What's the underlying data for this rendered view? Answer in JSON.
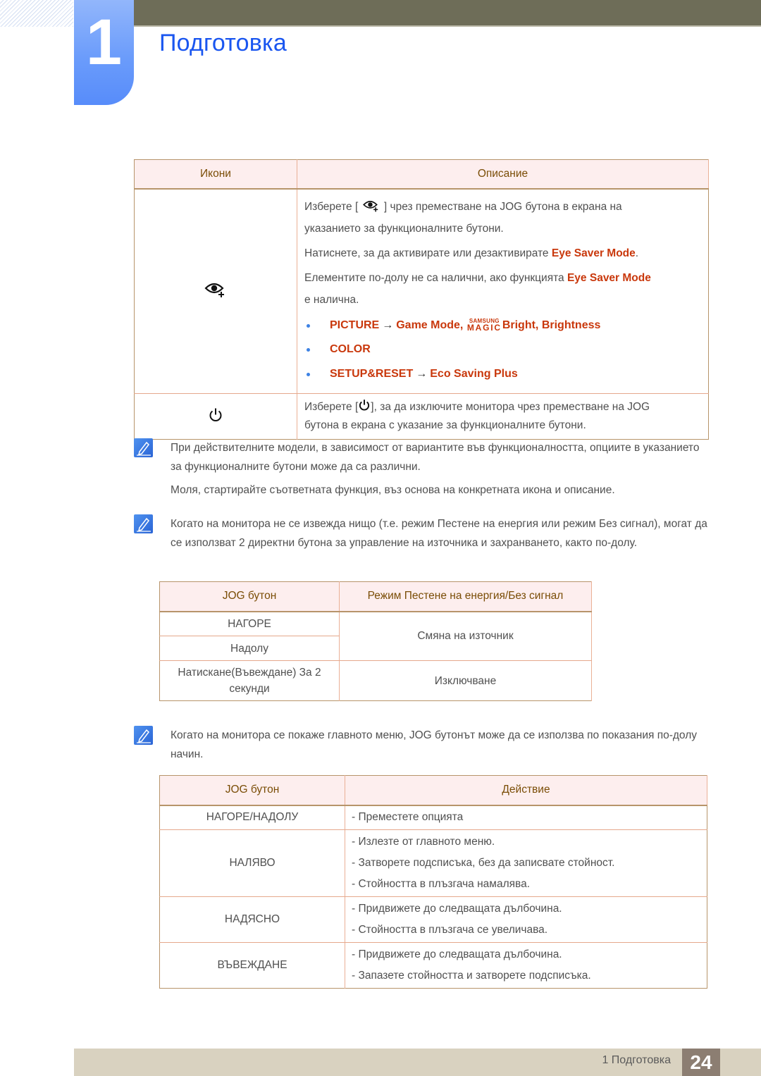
{
  "header": {
    "chapter_number": "1",
    "chapter_title": "Подготовка",
    "colors": {
      "topbar": "#6e6d58",
      "chapter_block": "#6b9cfb",
      "title": "#1a56f0"
    }
  },
  "icons_table": {
    "headers": [
      "Икони",
      "Описание"
    ],
    "rows": [
      {
        "icon": "eye-saver-icon",
        "desc": {
          "p1_before": "Изберете [",
          "p1_after": "] чрез преместване на JOG бутона в екрана на",
          "p1_line2": "указанието за функционалните бутони.",
          "p2_before": "Натиснете, за да активирате или дезактивирате ",
          "p2_hl": "Eye Saver Mode",
          "p2_after": ".",
          "p3_before": "Елементите по-долу не са налични, ако функцията ",
          "p3_hl": "Eye Saver Mode",
          "p3_line2": "е налична.",
          "bullets": [
            {
              "parts": [
                "PICTURE",
                "→",
                "Game Mode",
                ", ",
                "SAMSUNG",
                "MAGIC",
                "Bright",
                ", ",
                "Brightness"
              ]
            },
            {
              "parts": [
                "COLOR"
              ]
            },
            {
              "parts": [
                "SETUP&RESET",
                "→",
                "Eco Saving Plus"
              ]
            }
          ]
        }
      },
      {
        "icon": "power-icon",
        "desc": {
          "p1_before": "Изберете [",
          "p1_after": "], за да изключите монитора чрез преместване на JOG",
          "p1_line2": "бутона в екрана с указание за функционалните бутони."
        }
      }
    ]
  },
  "notes": [
    {
      "paragraphs": [
        "При действителните модели, в зависимост от вариантите във функционалността, опциите в указанието за функционалните бутони може да са различни.",
        "Моля, стартирайте съответната функция, въз основа на конкретната икона и описание."
      ]
    },
    {
      "paragraphs": [
        "Когато на монитора не се извежда нищо (т.е. режим Пестене на енергия или режим Без сигнал), могат да се използват 2 директни бутона за управление на източника и захранването, както по-долу."
      ]
    },
    {
      "paragraphs": [
        "Когато на монитора се покаже главното меню, JOG бутонът може да се използва по показания по-долу начин."
      ]
    }
  ],
  "power_saving_table": {
    "headers": [
      "JOG бутон",
      "Режим Пестене на енергия/Без сигнал"
    ],
    "rows": [
      {
        "button": "НАГОРЕ",
        "action": "Смяна на източник"
      },
      {
        "button": "Надолу"
      },
      {
        "button": "Натискане(Въвеждане) За 2 секунди",
        "action": "Изключване"
      }
    ]
  },
  "menu_table": {
    "headers": [
      "JOG бутон",
      "Действие"
    ],
    "rows": [
      {
        "button": "НАГОРЕ/НАДОЛУ",
        "actions": [
          "- Преместете опцията"
        ]
      },
      {
        "button": "НАЛЯВО",
        "actions": [
          "- Излезте от главното меню.",
          "- Затворете подсписъка, без да записвате стойност.",
          "- Стойността в плъзгача намалява."
        ]
      },
      {
        "button": "НАДЯСНО",
        "actions": [
          "- Придвижете до следващата дълбочина.",
          "- Стойността в плъзгача се увеличава."
        ]
      },
      {
        "button": "ВЪВЕЖДАНЕ",
        "actions": [
          "- Придвижете до следващата дълбочина.",
          "- Запазете стойността и затворете подсписъка."
        ]
      }
    ]
  },
  "footer": {
    "section_label": "1 Подготовка",
    "page_number": "24"
  }
}
